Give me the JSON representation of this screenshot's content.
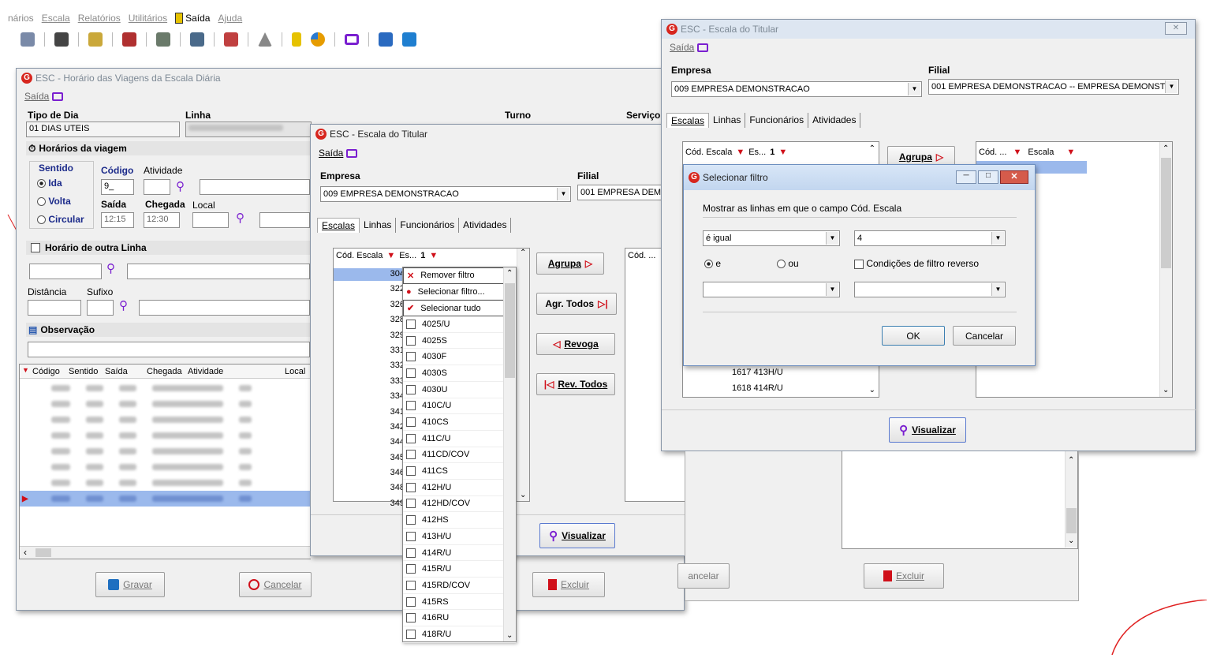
{
  "main_menu": {
    "items": [
      "nários",
      "Escala",
      "Relatórios",
      "Utilitários",
      "Saída",
      "Ajuda"
    ]
  },
  "toolbar": {
    "icons": [
      "person-edit-icon",
      "key-icon",
      "users-icon",
      "cancel-grid-icon",
      "bus-icon",
      "book-icon",
      "wrench-icon",
      "triangle-icon",
      "exit-icon",
      "pie-chart-icon",
      "monitor-icon",
      "tools-icon",
      "g-logo-icon"
    ]
  },
  "win1": {
    "title": "ESC - Horário das Viagens da Escala Diária",
    "menu_saida": "Saída",
    "tipo_dia_label": "Tipo de Dia",
    "tipo_dia_value": "01 DIAS UTEIS",
    "linha_label": "Linha",
    "turno_label": "Turno",
    "servico_label": "Serviço",
    "horarios_label": "Horários da viagem",
    "sentido_label": "Sentido",
    "ida": "Ida",
    "volta": "Volta",
    "circular": "Circular",
    "codigo_label": "Código",
    "codigo_value": "9_",
    "atividade_label": "Atividade",
    "saida_label": "Saída",
    "saida_value": "12:15",
    "chegada_label": "Chegada",
    "chegada_value": "12:30",
    "local_label": "Local",
    "outra_linha_label": "Horário de outra Linha",
    "distancia_label": "Distância",
    "sufixo_label": "Sufixo",
    "observacao_label": "Observação",
    "grid_headers": [
      "Código",
      "Sentido",
      "Saída",
      "Chegada",
      "Atividade",
      "Local"
    ],
    "gravar": "Gravar",
    "cancelar": "Cancelar",
    "excluir": "Excluir"
  },
  "win2": {
    "title": "ESC - Escala do Titular",
    "menu_saida": "Saída",
    "empresa_label": "Empresa",
    "empresa_value": "009 EMPRESA DEMONSTRACAO",
    "filial_label": "Filial",
    "filial_value": "001 EMPRESA DEMO",
    "tabs": [
      "Escalas",
      "Linhas",
      "Funcionários",
      "Atividades"
    ],
    "col_cod": "Cód. Escala",
    "col_es": "Es...",
    "sort_num": "1",
    "codes": [
      "304",
      "322",
      "326",
      "328",
      "329",
      "331",
      "332",
      "333",
      "334",
      "341",
      "342",
      "344",
      "345",
      "346",
      "348",
      "349"
    ],
    "right_col": "Cód. ...",
    "agrupa": "Agrupa",
    "agr_todos": "Agr. Todos",
    "revoga": "Revoga",
    "rev_todos": "Rev. Todos",
    "visualizar": "Visualizar"
  },
  "dropdown": {
    "remover": "Remover filtro",
    "selecionar_filtro": "Selecionar filtro...",
    "selecionar_tudo": "Selecionar tudo",
    "items": [
      "4025/U",
      "4025S",
      "4030F",
      "4030S",
      "4030U",
      "410C/U",
      "410CS",
      "411C/U",
      "411CD/COV",
      "411CS",
      "412H/U",
      "412HD/COV",
      "412HS",
      "413H/U",
      "414R/U",
      "415R/U",
      "415RD/COV",
      "415RS",
      "416RU",
      "418R/U"
    ]
  },
  "win3": {
    "title": "ESC - Escala do Titular",
    "menu_saida": "Saída",
    "close": "✕",
    "empresa_label": "Empresa",
    "empresa_value": "009 EMPRESA DEMONSTRACAO",
    "filial_label": "Filial",
    "filial_value": "001 EMPRESA DEMONSTRACAO -- EMPRESA DEMONSTR",
    "tabs": [
      "Escalas",
      "Linhas",
      "Funcionários",
      "Atividades"
    ],
    "col_cod": "Cód. Escala",
    "col_es": "Es...",
    "sort_num": "1",
    "right_cod": "Cód. ...",
    "right_escala": "Escala",
    "agrupa": "Agrupa",
    "rows": [
      {
        "code": "1617",
        "escala": "413H/U"
      },
      {
        "code": "1618",
        "escala": "414R/U"
      }
    ],
    "visualizar": "Visualizar",
    "cancelar": "ancelar",
    "excluir": "Excluir"
  },
  "filter_dialog": {
    "title": "Selecionar filtro",
    "prompt": "Mostrar as linhas em que o campo Cód. Escala",
    "operator": "é igual",
    "value": "4",
    "opt_e": "e",
    "opt_ou": "ou",
    "reverse": "Condições de filtro reverso",
    "ok": "OK",
    "cancel": "Cancelar"
  }
}
